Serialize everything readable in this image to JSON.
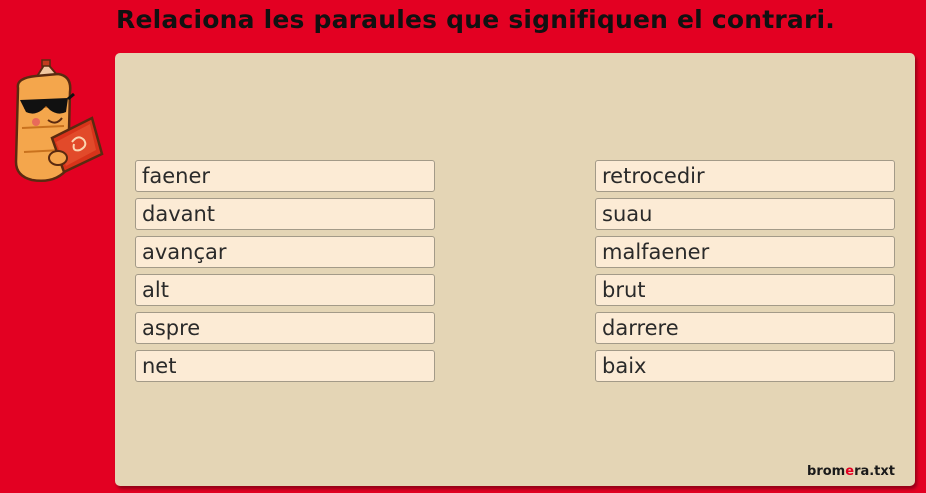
{
  "title": "Relaciona les paraules que signifiquen el contrari.",
  "left_words": [
    "faener",
    "davant",
    "avançar",
    "alt",
    "aspre",
    "net"
  ],
  "right_words": [
    "retrocedir",
    "suau",
    "malfaener",
    "brut",
    "darrere",
    "baix"
  ],
  "brand": {
    "prefix": "brom",
    "accent": "e",
    "suffix": "ra.txt"
  },
  "colors": {
    "background": "#e30022",
    "panel": "#e4d5b5",
    "word_box": "#fcebd5"
  },
  "mascot_icon": "pencil-mascot-with-book-icon"
}
